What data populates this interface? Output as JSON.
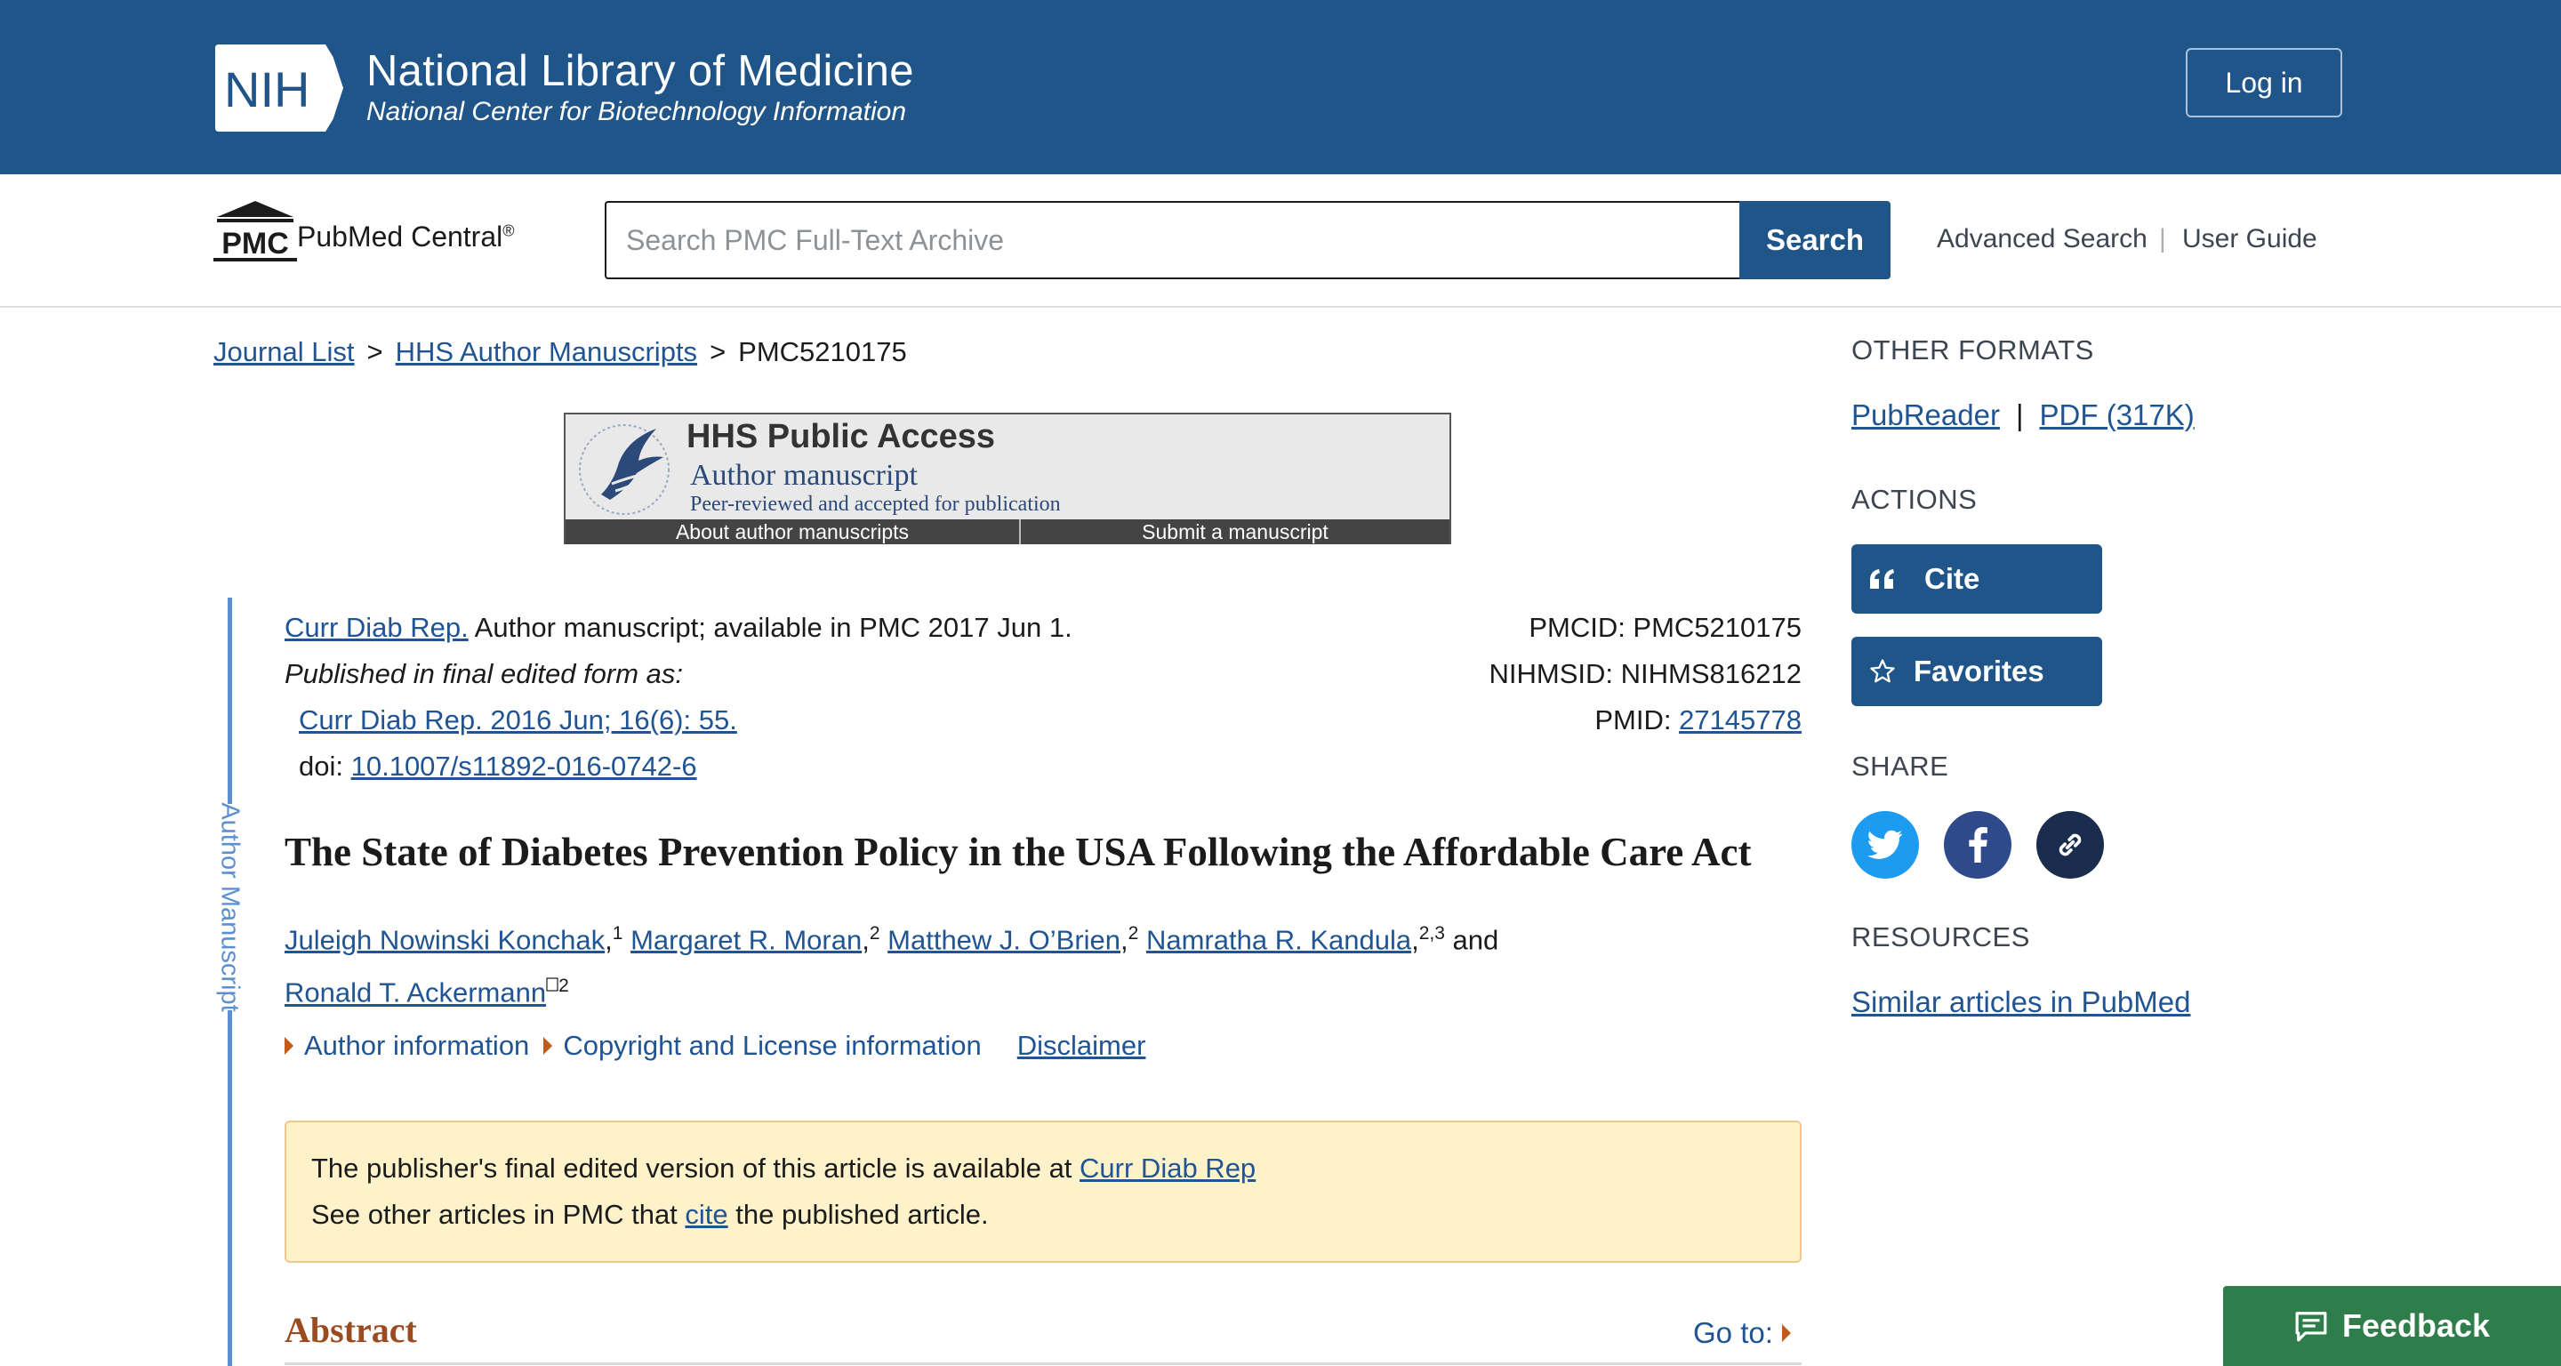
{
  "header": {
    "org_logo_text": "NIH",
    "title": "National Library of Medicine",
    "subtitle": "National Center for Biotechnology Information",
    "login_label": "Log in"
  },
  "search": {
    "logo_text": "PMC",
    "brand": "PubMed Central",
    "brand_mark": "®",
    "placeholder": "Search PMC Full-Text Archive",
    "value": "",
    "button_label": "Search",
    "advanced_label": "Advanced Search",
    "separator": "|",
    "guide_label": "User Guide"
  },
  "breadcrumb": {
    "items": [
      "Journal List",
      "HHS Author Manuscripts",
      "PMC5210175"
    ],
    "separator": ">"
  },
  "hhs_banner": {
    "title": "HHS Public Access",
    "subtitle": "Author manuscript",
    "note": "Peer-reviewed and accepted for publication",
    "about_label": "About author manuscripts",
    "submit_label": "Submit a manuscript"
  },
  "side_label": "Author Manuscript",
  "citation": {
    "journal_link": "Curr Diab Rep.",
    "availability": " Author manuscript; available in PMC 2017 Jun 1.",
    "published_as": "Published in final edited form as:",
    "final_ref": "Curr Diab Rep. 2016 Jun; 16(6): 55.",
    "doi_label": "doi: ",
    "doi_value": "10.1007/s11892-016-0742-6",
    "pmcid": "PMCID: PMC5210175",
    "nihmsid": "NIHMSID: NIHMS816212",
    "pmid_label": "PMID: ",
    "pmid_value": "27145778"
  },
  "article": {
    "title": "The State of Diabetes Prevention Policy in the USA Following the Affordable Care Act",
    "authors": [
      {
        "name": "Juleigh Nowinski Konchak",
        "aff": "1"
      },
      {
        "name": "Margaret R. Moran",
        "aff": "2"
      },
      {
        "name": "Matthew J. O’Brien",
        "aff": "2"
      },
      {
        "name": "Namratha R. Kandula",
        "aff": "2,3"
      },
      {
        "name": "Ronald T. Ackermann",
        "aff": "2"
      }
    ],
    "author_joiner": " and",
    "author_info_label": "Author information",
    "copyright_label": "Copyright and License information",
    "disclaimer_label": "Disclaimer"
  },
  "notice": {
    "line1_text": "The publisher's final edited version of this article is available at ",
    "line1_link": "Curr Diab Rep",
    "line2_pre": "See other articles in PMC that ",
    "line2_link": "cite",
    "line2_post": " the published article."
  },
  "abstract": {
    "heading": "Abstract",
    "goto_label": "Go to:"
  },
  "sidebar": {
    "other_formats_heading": "OTHER FORMATS",
    "pubreader_label": "PubReader",
    "format_separator": "|",
    "pdf_label": "PDF (317K)",
    "actions_heading": "ACTIONS",
    "cite_label": "Cite",
    "favorites_label": "Favorites",
    "share_heading": "SHARE",
    "resources_heading": "RESOURCES",
    "similar_label": "Similar articles in PubMed"
  },
  "feedback_label": "Feedback",
  "colors": {
    "brand_blue": "#20558a",
    "link_blue": "#205493",
    "twitter": "#1d9bf0",
    "facebook": "#2f4a8a",
    "link_share": "#1a2d4e",
    "notice_bg": "#fef2cb",
    "feedback_green": "#2e7d4a",
    "abstract_accent": "#9a4b20"
  }
}
